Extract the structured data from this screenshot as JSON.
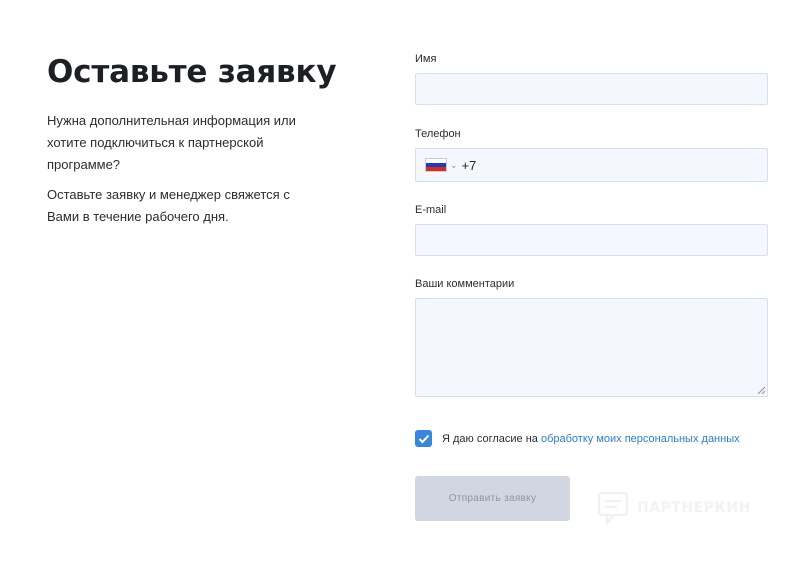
{
  "left": {
    "title": "Оставьте заявку",
    "paragraph1": "Нужна дополнительная информация или хотите подключиться к партнерской программе?",
    "paragraph2": "Оставьте заявку и менеджер свяжется с Вами в течение рабочего дня."
  },
  "form": {
    "name_label": "Имя",
    "name_value": "",
    "phone_label": "Телефон",
    "phone_code": "+7",
    "phone_value": "",
    "email_label": "E-mail",
    "email_value": "",
    "comment_label": "Ваши комментарии",
    "comment_value": "",
    "consent_checked": true,
    "consent_text": "Я даю согласие на ",
    "consent_link": "обработку моих персональных данных",
    "submit_label": "Отправить заявку"
  },
  "watermark": {
    "text": "ПАРТНЕРКИН"
  },
  "colors": {
    "accent": "#3b86d8",
    "link": "#2f7dc9",
    "input_bg": "#f4f7fd",
    "button_disabled": "#d2d6e0"
  },
  "icons": {
    "flag": "russia-flag-icon",
    "chevron": "chevron-down-icon",
    "check": "checkmark-icon",
    "resize": "resize-grip-icon",
    "watermark": "partnerkin-logo-icon"
  }
}
